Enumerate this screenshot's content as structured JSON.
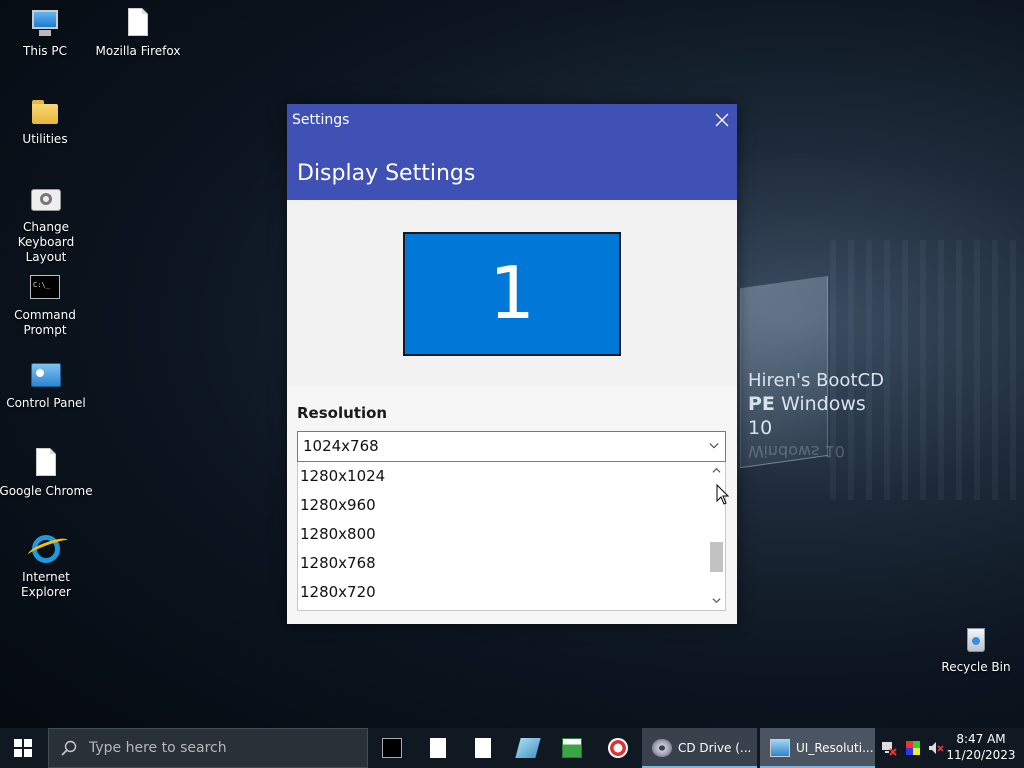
{
  "desktop": {
    "icons": [
      {
        "label": "This PC",
        "icon": "computer-icon"
      },
      {
        "label": "Mozilla Firefox",
        "icon": "file-icon"
      },
      {
        "label": "Utilities",
        "icon": "folder-icon"
      },
      {
        "label": "Change Keyboard Layout",
        "icon": "keyboard-settings-icon"
      },
      {
        "label": "Command Prompt",
        "icon": "command-prompt-icon"
      },
      {
        "label": "Control Panel",
        "icon": "control-panel-icon"
      },
      {
        "label": "Google Chrome",
        "icon": "file-icon"
      },
      {
        "label": "Internet Explorer",
        "icon": "internet-explorer-icon"
      },
      {
        "label": "Recycle Bin",
        "icon": "recycle-bin-icon"
      }
    ],
    "wallpaper_brand": {
      "line1": "Hiren's BootCD",
      "line2_bold": "PE",
      "line2_rest": " Windows 10",
      "mirror": "Windows 10"
    }
  },
  "window": {
    "title": "Settings",
    "close_icon": "close-icon",
    "header": "Display Settings",
    "monitor_number": "1",
    "resolution_label": "Resolution",
    "resolution_selected": "1024x768",
    "resolution_options": [
      "1280x1024",
      "1280x960",
      "1280x800",
      "1280x768",
      "1280x720"
    ],
    "accent_color": "#3f51b5",
    "monitor_color": "#0078d7"
  },
  "taskbar": {
    "search_placeholder": "Type here to search",
    "pinned": [
      "command-prompt-icon",
      "file-icon",
      "file-icon",
      "notepad-icon",
      "chart-app-icon",
      "screenshot-tool-icon"
    ],
    "tasks": [
      {
        "label": "CD Drive (...",
        "icon": "cd-drive-icon",
        "active": false
      },
      {
        "label": "UI_Resoluti...",
        "icon": "settings-app-icon",
        "active": true
      }
    ],
    "tray": [
      "network-icon",
      "color-app-icon",
      "speaker-muted-icon"
    ],
    "time": "8:47 AM",
    "date": "11/20/2023"
  }
}
